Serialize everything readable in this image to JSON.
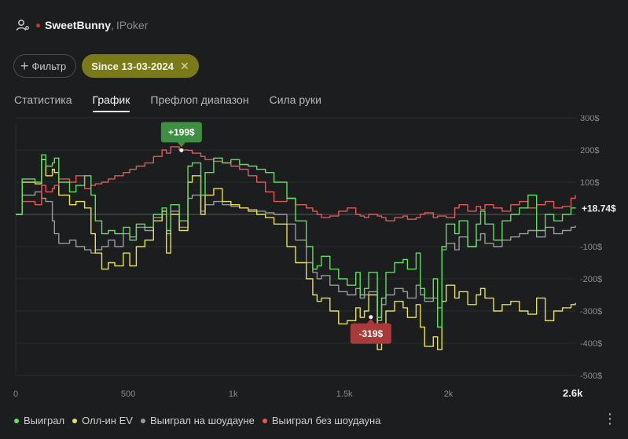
{
  "header": {
    "player_name": "SweetBunny",
    "separator": ",",
    "room": "IPoker"
  },
  "filters": {
    "add_filter_label": "Фильтр",
    "active_chip_label": "Since 13-03-2024",
    "chip_remove_glyph": "✕"
  },
  "tabs": [
    {
      "label": "Статистика",
      "active": false
    },
    {
      "label": "График",
      "active": true
    },
    {
      "label": "Префлоп диапазон",
      "active": false
    },
    {
      "label": "Сила руки",
      "active": false
    }
  ],
  "legend": [
    {
      "label": "Выиграл",
      "color": "#5ee05e"
    },
    {
      "label": "Олл-ин EV",
      "color": "#e6e24a"
    },
    {
      "label": "Выиграл на шоудауне",
      "color": "#9a9a9a"
    },
    {
      "label": "Выиграл без шоудауна",
      "color": "#e05a5a"
    }
  ],
  "more_glyph": "⋮",
  "chart_data": {
    "type": "line",
    "x_ticks": [
      "0",
      "500",
      "1k",
      "1.5k",
      "2k",
      "2.6k"
    ],
    "x_tick_values": [
      0,
      500,
      1000,
      1500,
      2000,
      2600
    ],
    "y_ticks": [
      "300$",
      "200$",
      "100$",
      "",
      "-100$",
      "-200$",
      "-300$",
      "-400$",
      "-500$"
    ],
    "y_tick_values": [
      300,
      200,
      100,
      0,
      -100,
      -200,
      -300,
      -400,
      -500
    ],
    "xlim": [
      0,
      2600
    ],
    "ylim": [
      -500,
      300
    ],
    "grid": true,
    "annotations": [
      {
        "text": "+199$",
        "x": 770,
        "y": 199,
        "color": "#3d8f42"
      },
      {
        "text": "-319$",
        "x": 1650,
        "y": -319,
        "color": "#a83a3a"
      }
    ],
    "end_label": "+18.74$",
    "series": [
      {
        "name": "Выиграл",
        "color": "#5ee05e",
        "x": [
          0,
          30,
          90,
          120,
          140,
          170,
          180,
          200,
          250,
          280,
          320,
          350,
          370,
          400,
          430,
          460,
          500,
          530,
          560,
          600,
          640,
          680,
          700,
          720,
          760,
          800,
          820,
          860,
          880,
          920,
          960,
          1000,
          1040,
          1080,
          1120,
          1160,
          1200,
          1260,
          1300,
          1350,
          1380,
          1400,
          1420,
          1460,
          1500,
          1540,
          1580,
          1600,
          1620,
          1640,
          1680,
          1700,
          1720,
          1760,
          1800,
          1820,
          1860,
          1880,
          1900,
          1940,
          1960,
          1980,
          2000,
          2040,
          2060,
          2100,
          2140,
          2160,
          2180,
          2220,
          2260,
          2300,
          2340,
          2380,
          2420,
          2460,
          2500,
          2540,
          2580,
          2600
        ],
        "y": [
          0,
          110,
          100,
          185,
          150,
          160,
          175,
          100,
          70,
          90,
          120,
          60,
          -20,
          -60,
          -50,
          -60,
          -40,
          -80,
          -30,
          -40,
          0,
          20,
          -50,
          30,
          -20,
          150,
          160,
          60,
          130,
          175,
          160,
          170,
          155,
          150,
          140,
          130,
          100,
          50,
          -20,
          -100,
          -170,
          -160,
          -130,
          -170,
          -200,
          -220,
          -180,
          -250,
          -230,
          -180,
          -320,
          -260,
          -180,
          -150,
          -140,
          -170,
          -120,
          -230,
          -260,
          -200,
          -350,
          -100,
          -30,
          -60,
          -20,
          -100,
          -30,
          10,
          -30,
          -80,
          -20,
          0,
          20,
          60,
          -50,
          0,
          -20,
          0,
          20,
          18.74
        ]
      },
      {
        "name": "Олл-ин EV",
        "color": "#e6e24a",
        "x": [
          0,
          30,
          90,
          120,
          140,
          170,
          180,
          200,
          250,
          280,
          320,
          350,
          370,
          400,
          430,
          460,
          500,
          530,
          560,
          600,
          640,
          680,
          700,
          720,
          760,
          800,
          820,
          860,
          880,
          920,
          960,
          1000,
          1040,
          1080,
          1120,
          1160,
          1200,
          1260,
          1300,
          1350,
          1380,
          1400,
          1420,
          1460,
          1500,
          1540,
          1580,
          1600,
          1620,
          1640,
          1680,
          1700,
          1720,
          1760,
          1800,
          1820,
          1860,
          1880,
          1900,
          1940,
          1960,
          1980,
          2000,
          2040,
          2060,
          2100,
          2140,
          2160,
          2180,
          2220,
          2260,
          2300,
          2340,
          2380,
          2420,
          2460,
          2500,
          2540,
          2580,
          2600
        ],
        "y": [
          0,
          100,
          95,
          170,
          120,
          140,
          130,
          60,
          30,
          40,
          20,
          -60,
          -120,
          -170,
          -150,
          -160,
          -120,
          -160,
          -100,
          -80,
          -20,
          10,
          -120,
          0,
          -50,
          100,
          120,
          0,
          60,
          80,
          40,
          30,
          20,
          10,
          0,
          -10,
          -30,
          -100,
          -150,
          -200,
          -250,
          -270,
          -260,
          -300,
          -340,
          -330,
          -290,
          -320,
          -300,
          -250,
          -420,
          -340,
          -300,
          -270,
          -290,
          -320,
          -280,
          -350,
          -410,
          -380,
          -420,
          -270,
          -220,
          -260,
          -240,
          -280,
          -250,
          -230,
          -260,
          -300,
          -280,
          -270,
          -300,
          -310,
          -260,
          -330,
          -300,
          -290,
          -280,
          -275
        ]
      },
      {
        "name": "Выиграл на шоудауне",
        "color": "#9a9a9a",
        "x": [
          0,
          30,
          90,
          120,
          140,
          170,
          180,
          200,
          250,
          280,
          320,
          350,
          370,
          400,
          430,
          460,
          500,
          530,
          560,
          600,
          640,
          680,
          700,
          720,
          760,
          800,
          820,
          860,
          880,
          920,
          960,
          1000,
          1040,
          1080,
          1120,
          1160,
          1200,
          1260,
          1300,
          1350,
          1380,
          1400,
          1420,
          1460,
          1500,
          1540,
          1580,
          1600,
          1620,
          1640,
          1680,
          1700,
          1720,
          1760,
          1800,
          1820,
          1860,
          1880,
          1900,
          1940,
          1960,
          1980,
          2000,
          2040,
          2060,
          2100,
          2140,
          2160,
          2180,
          2220,
          2260,
          2300,
          2340,
          2380,
          2420,
          2460,
          2500,
          2540,
          2580,
          2600
        ],
        "y": [
          0,
          60,
          70,
          50,
          40,
          -20,
          -60,
          -90,
          -80,
          -100,
          -110,
          -120,
          -110,
          -100,
          -80,
          -100,
          -60,
          -70,
          -40,
          -50,
          -10,
          0,
          -60,
          10,
          -40,
          50,
          60,
          10,
          30,
          40,
          30,
          25,
          20,
          15,
          10,
          5,
          0,
          -30,
          -80,
          -150,
          -180,
          -200,
          -190,
          -220,
          -240,
          -250,
          -230,
          -260,
          -250,
          -240,
          -330,
          -280,
          -250,
          -230,
          -240,
          -260,
          -220,
          -250,
          -270,
          -260,
          -290,
          -110,
          -90,
          -110,
          -70,
          -100,
          -80,
          -60,
          -90,
          -100,
          -80,
          -70,
          -60,
          -50,
          -70,
          -40,
          -60,
          -50,
          -40,
          -35
        ]
      },
      {
        "name": "Выиграл без шоудауна",
        "color": "#e05a5a",
        "x": [
          0,
          30,
          90,
          120,
          140,
          170,
          180,
          200,
          250,
          280,
          320,
          350,
          370,
          400,
          430,
          460,
          500,
          530,
          560,
          600,
          640,
          680,
          700,
          720,
          760,
          800,
          820,
          860,
          880,
          920,
          960,
          1000,
          1040,
          1080,
          1120,
          1160,
          1200,
          1260,
          1300,
          1350,
          1380,
          1400,
          1420,
          1460,
          1500,
          1540,
          1580,
          1600,
          1620,
          1640,
          1680,
          1700,
          1720,
          1760,
          1800,
          1820,
          1860,
          1880,
          1900,
          1940,
          1960,
          1980,
          2000,
          2040,
          2060,
          2100,
          2140,
          2160,
          2180,
          2220,
          2260,
          2300,
          2340,
          2380,
          2420,
          2460,
          2500,
          2540,
          2580,
          2600
        ],
        "y": [
          0,
          40,
          30,
          90,
          70,
          80,
          90,
          110,
          100,
          120,
          80,
          90,
          95,
          100,
          110,
          120,
          130,
          140,
          150,
          160,
          180,
          200,
          190,
          210,
          200,
          199,
          190,
          180,
          170,
          165,
          160,
          150,
          140,
          120,
          100,
          70,
          40,
          50,
          30,
          20,
          10,
          0,
          -10,
          -5,
          10,
          20,
          0,
          -5,
          -10,
          0,
          -5,
          -10,
          -20,
          -10,
          -5,
          -15,
          -10,
          0,
          5,
          -10,
          -5,
          -5,
          -10,
          20,
          30,
          10,
          25,
          15,
          30,
          20,
          10,
          30,
          40,
          20,
          30,
          40,
          20,
          25,
          50,
          60
        ]
      }
    ]
  }
}
